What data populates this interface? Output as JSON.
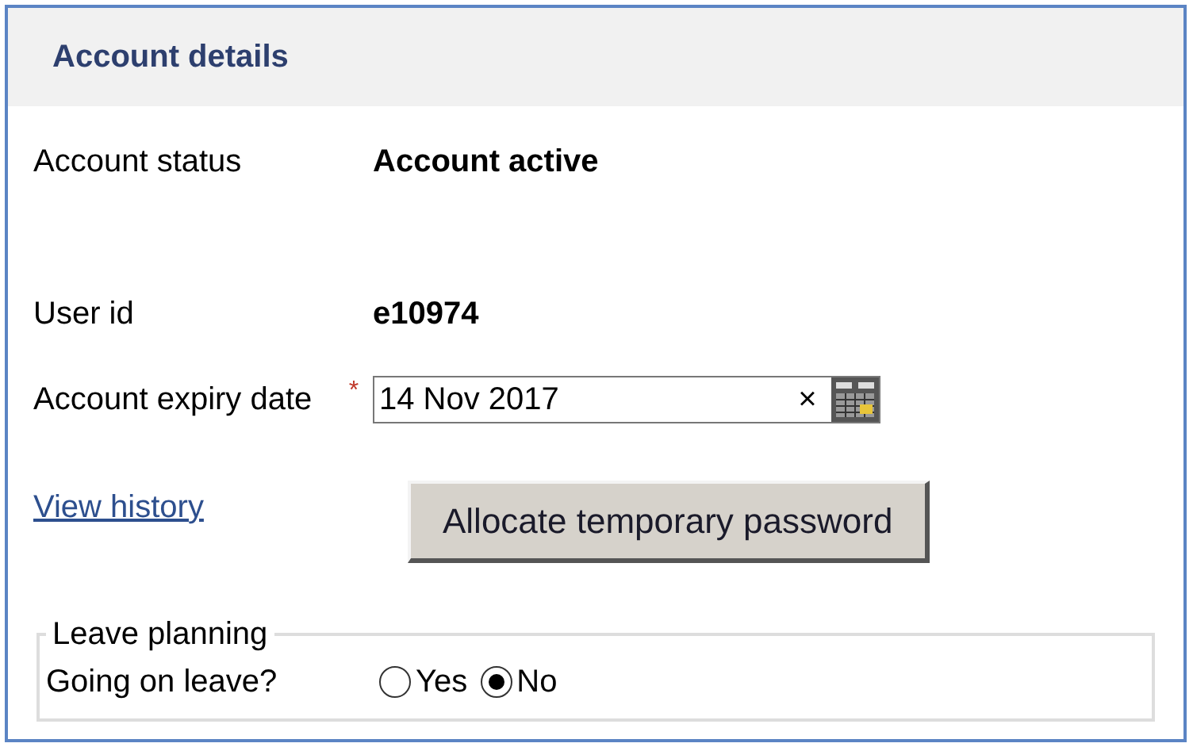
{
  "panel": {
    "title": "Account details"
  },
  "fields": [
    {
      "label": "Account status",
      "value": "Account active"
    },
    {
      "label": "User id",
      "value": "e10974"
    }
  ],
  "expiry": {
    "label": "Account expiry date",
    "required_mark": "*",
    "value": "14 Nov 2017",
    "clear": "×"
  },
  "link": "View history",
  "button": "Allocate temporary password",
  "leave": {
    "legend": "Leave planning",
    "question": "Going on leave?",
    "options": [
      {
        "label": "Yes",
        "selected": false
      },
      {
        "label": "No",
        "selected": true
      }
    ]
  }
}
